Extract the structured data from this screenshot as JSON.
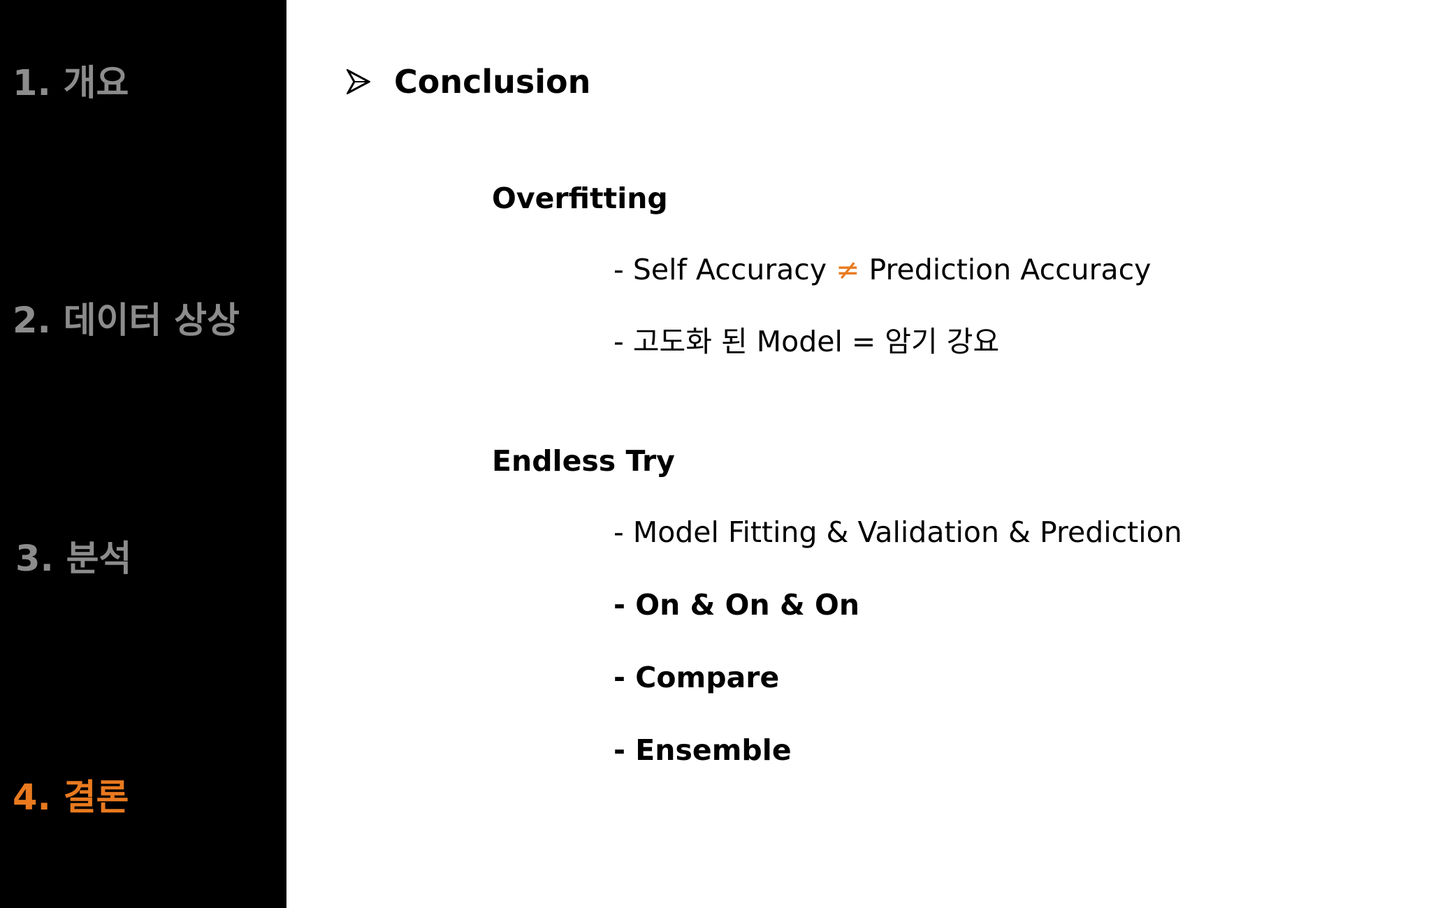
{
  "sidebar": {
    "items": [
      {
        "label": "1. 개요"
      },
      {
        "label": "2. 데이터 상상"
      },
      {
        "label": "3. 분석"
      },
      {
        "label": "4. 결론"
      }
    ],
    "active_color": "#e97a1f",
    "inactive_color": "#8c8c8c"
  },
  "main": {
    "heading": "Conclusion",
    "bullet_icon": "arrowhead-bullet-icon",
    "sections": [
      {
        "title": "Overfitting",
        "lines": [
          {
            "before": "- Self Accuracy ",
            "symbol": "≠",
            "after": " Prediction Accuracy"
          },
          {
            "text": "- 고도화 된 Model = 암기 강요"
          }
        ]
      },
      {
        "title": "Endless Try",
        "lines": [
          {
            "text": "- Model Fitting & Validation & Prediction"
          },
          {
            "text": "- On & On & On"
          },
          {
            "text": "- Compare"
          },
          {
            "text": "- Ensemble"
          }
        ]
      }
    ]
  }
}
